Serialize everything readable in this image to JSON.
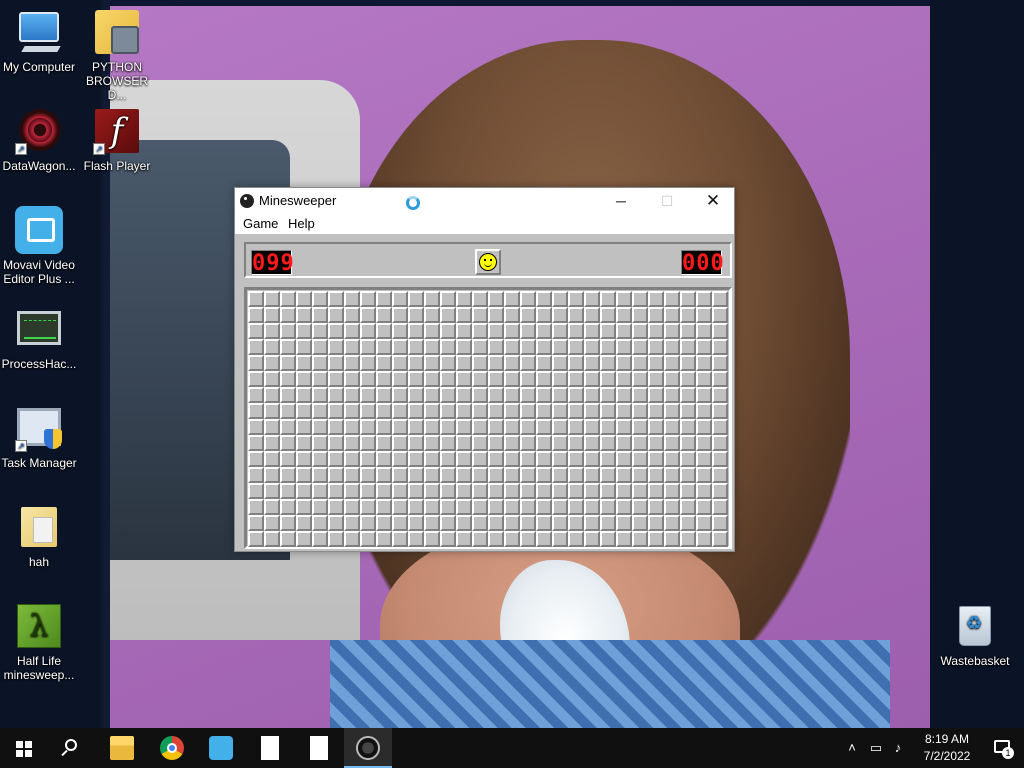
{
  "desktop": {
    "icons": [
      {
        "label": "My Computer",
        "icon": "computer-icon"
      },
      {
        "label": "PYTHON BROWSER D...",
        "icon": "python-folder-icon"
      },
      {
        "label": "DataWagon...",
        "icon": "datawagon-icon"
      },
      {
        "label": "Flash Player",
        "icon": "flash-icon"
      },
      {
        "label": "Movavi Video Editor Plus ...",
        "icon": "movavi-icon"
      },
      {
        "label": "ProcessHac...",
        "icon": "processhacker-icon"
      },
      {
        "label": "Task Manager",
        "icon": "taskmanager-icon"
      },
      {
        "label": "hah",
        "icon": "folder-icon"
      },
      {
        "label": "Half Life minesweep...",
        "icon": "halflife-icon"
      },
      {
        "label": "Wastebasket",
        "icon": "recycle-bin-icon"
      }
    ]
  },
  "window": {
    "title": "Minesweeper",
    "menu": [
      "Game",
      "Help"
    ],
    "minimize": "─",
    "maximize": "☐",
    "close": "✕"
  },
  "game": {
    "mines_remaining": "099",
    "timer": "000",
    "face": "smile",
    "rows": 16,
    "cols": 30
  },
  "taskbar": {
    "apps": [
      "file-explorer",
      "chrome",
      "movavi",
      "file",
      "file",
      "minesweeper"
    ],
    "active_app": "minesweeper",
    "tray": {
      "chevron": "˄",
      "network": "▭",
      "volume": "♪",
      "time": "8:19 AM",
      "date": "7/2/2022",
      "notifications": "1"
    }
  },
  "colors": {
    "led_red": "#ff1a1a",
    "board_gray": "#c0c0c0",
    "taskbar": "#101010",
    "accent": "#76b9ed"
  }
}
